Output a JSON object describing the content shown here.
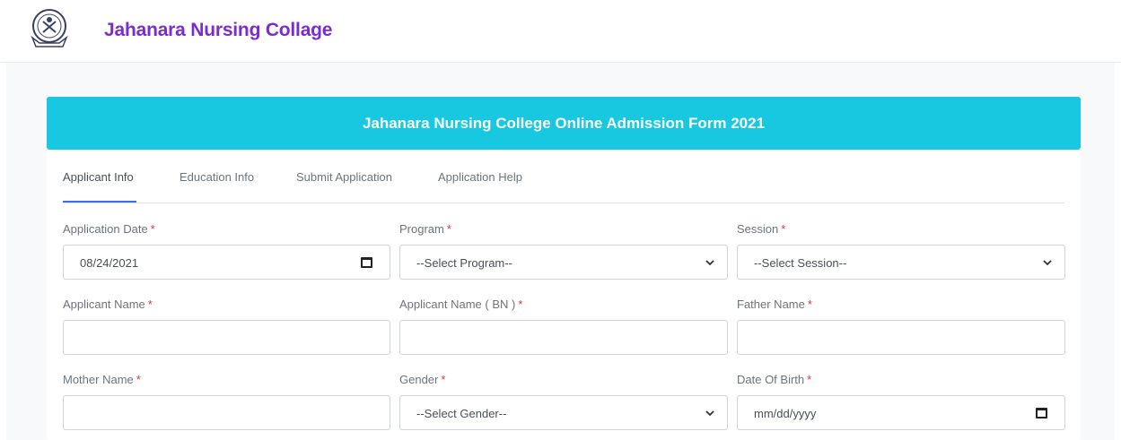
{
  "header": {
    "brand": "Jahanara Nursing Collage",
    "logo_icon": "college-seal-logo"
  },
  "banner": {
    "title": "Jahanara Nursing College Online Admission Form 2021"
  },
  "tabs": [
    {
      "label": "Applicant Info",
      "active": true
    },
    {
      "label": "Education Info",
      "active": false
    },
    {
      "label": "Submit Application",
      "active": false
    },
    {
      "label": "Application Help",
      "active": false
    }
  ],
  "form": {
    "application_date": {
      "label": "Application Date",
      "value": "08/24/2021"
    },
    "program": {
      "label": "Program",
      "selected": "--Select Program--"
    },
    "session": {
      "label": "Session",
      "selected": "--Select Session--"
    },
    "applicant_name": {
      "label": "Applicant Name",
      "value": ""
    },
    "applicant_name_bn": {
      "label": "Applicant Name ( BN )",
      "value": ""
    },
    "father_name": {
      "label": "Father Name",
      "value": ""
    },
    "mother_name": {
      "label": "Mother Name",
      "value": ""
    },
    "gender": {
      "label": "Gender",
      "selected": "--Select Gender--"
    },
    "date_of_birth": {
      "label": "Date Of Birth",
      "placeholder": "mm/dd/yyyy"
    },
    "required_mark": "*"
  },
  "colors": {
    "brand": "#7b2ad6",
    "banner": "#17c8e0",
    "active_tab_underline": "#3d6fd6",
    "required": "#e3342f"
  }
}
